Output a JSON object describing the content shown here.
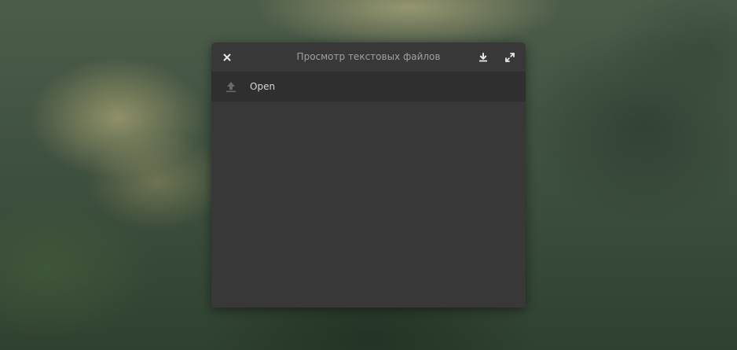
{
  "window": {
    "title": "Просмотр текстовых файлов"
  },
  "titlebar": {
    "close_icon": "close-icon",
    "download_icon": "download-icon",
    "maximize_icon": "maximize-icon"
  },
  "toolbar": {
    "open_label": "Open",
    "open_icon": "upload-icon"
  },
  "colors": {
    "window_bg": "#383838",
    "toolbar_bg": "#2f2f2f",
    "title_text": "#a0a0a0",
    "label_text": "#d6d6d6",
    "icon_light": "#e8e8e8",
    "icon_dim": "#6a6a6a"
  }
}
